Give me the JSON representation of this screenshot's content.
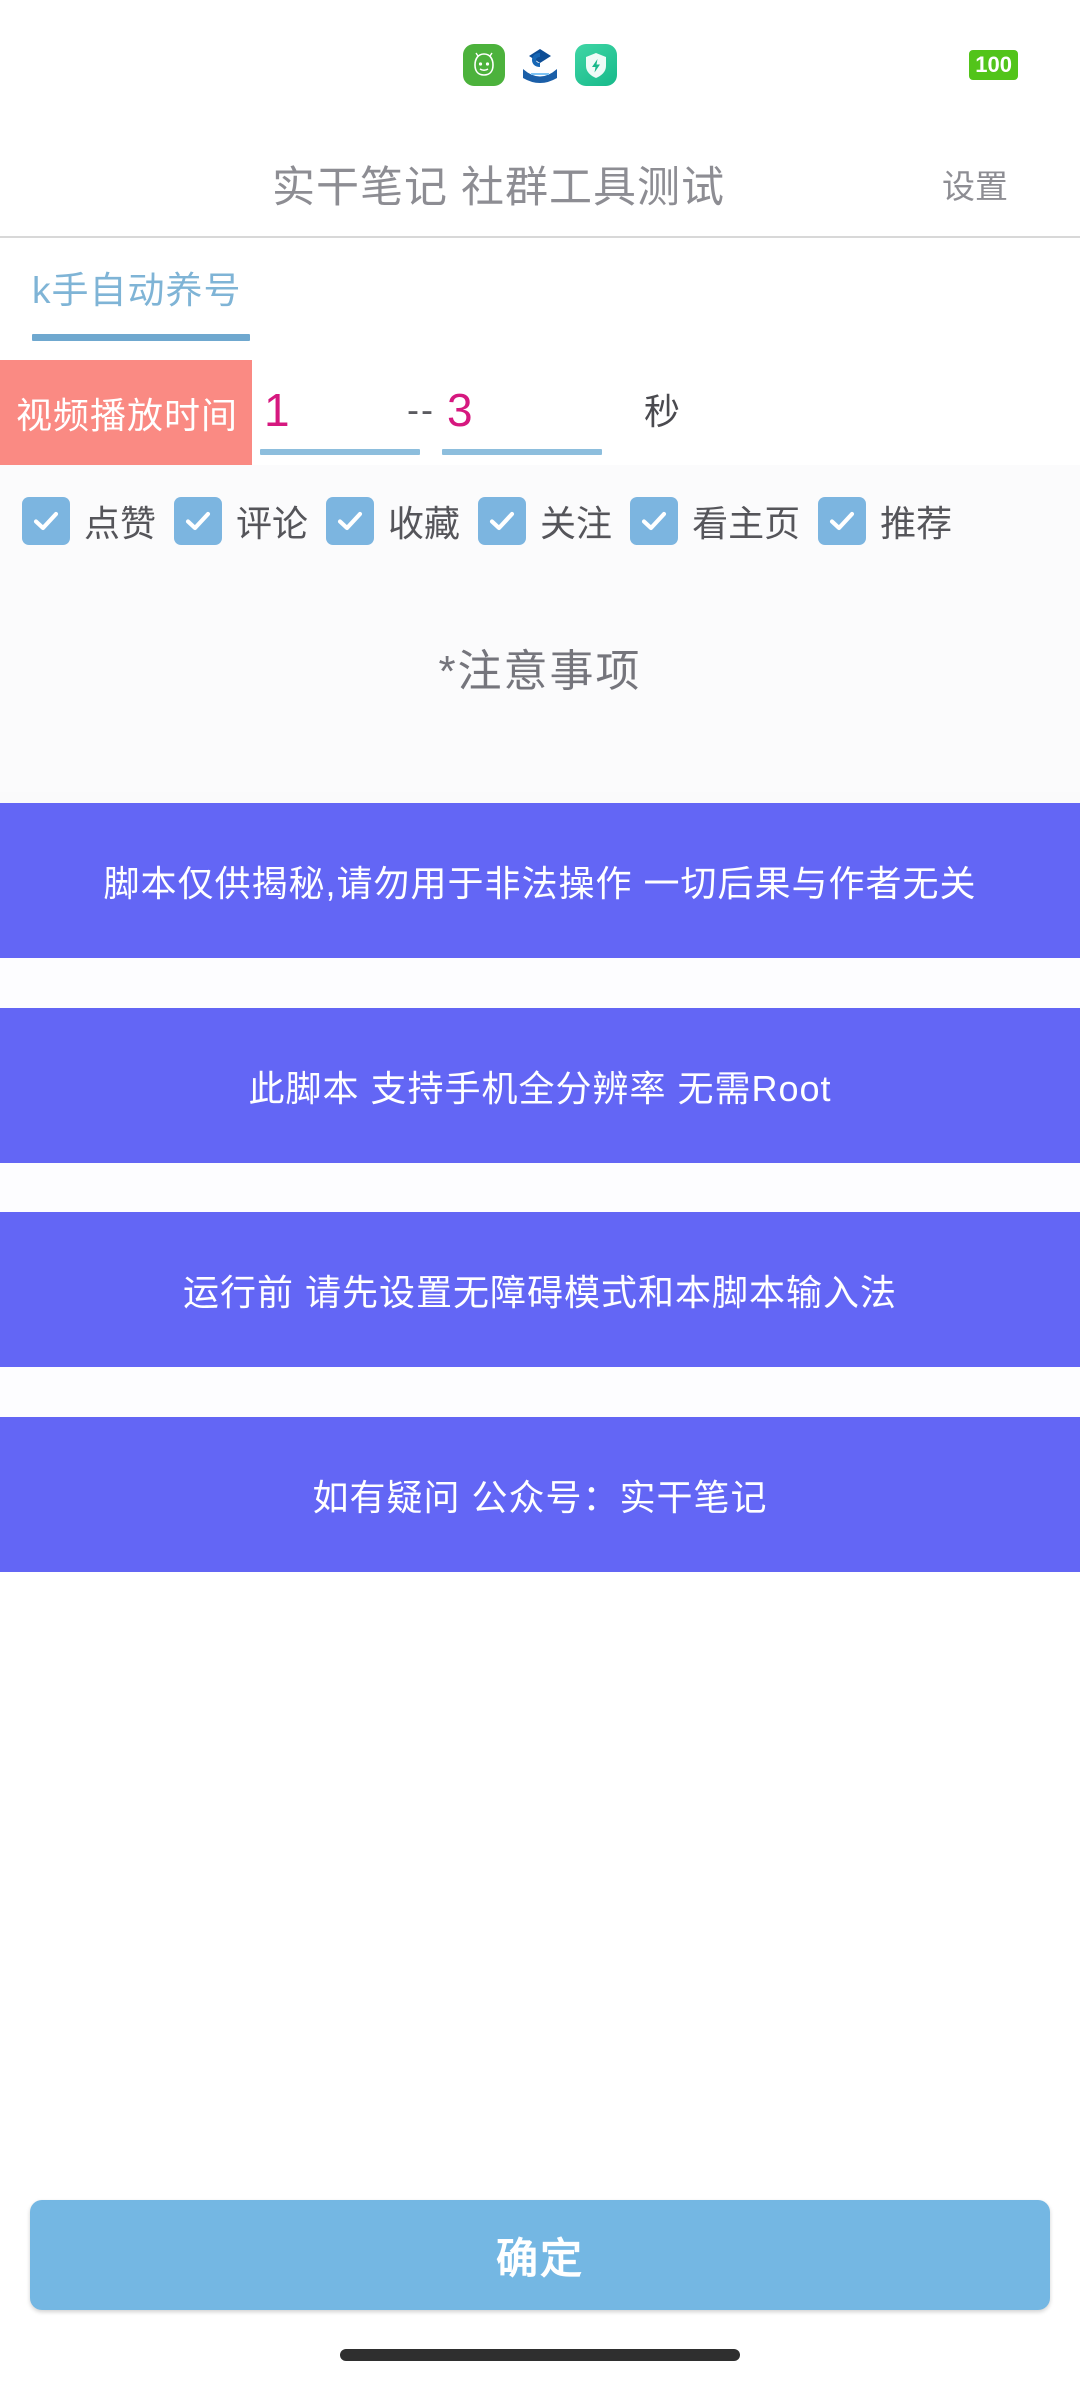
{
  "status_bar": {
    "notification_icons": [
      {
        "name": "robot-app-icon",
        "glyph": "robot"
      },
      {
        "name": "bank-app-icon",
        "glyph": "ccb-bank"
      },
      {
        "name": "security-shield-icon",
        "glyph": "shield-bolt"
      }
    ],
    "battery_level": "100"
  },
  "header": {
    "title": "实干笔记 社群工具测试",
    "settings_label": "设置"
  },
  "tabs": [
    {
      "label": "k手自动养号",
      "active": true
    }
  ],
  "form": {
    "time_label": "视频播放时间",
    "min_value": "1",
    "separator": "--",
    "max_value": "3",
    "unit": "秒",
    "min_placeholder": "1",
    "max_placeholder": "3"
  },
  "checkboxes": [
    {
      "label": "点赞",
      "checked": true
    },
    {
      "label": "评论",
      "checked": true
    },
    {
      "label": "收藏",
      "checked": true
    },
    {
      "label": "关注",
      "checked": true
    },
    {
      "label": "看主页",
      "checked": true
    },
    {
      "label": "推荐",
      "checked": true
    }
  ],
  "notes": {
    "heading": "*注意事项",
    "banners": [
      "脚本仅供揭秘,请勿用于非法操作 一切后果与作者无关",
      "此脚本 支持手机全分辨率 无需Root",
      "运行前 请先设置无障碍模式和本脚本输入法",
      "如有疑问 公众号：实干笔记"
    ]
  },
  "footer": {
    "confirm_label": "确定"
  },
  "colors": {
    "accent_blue": "#7cb5e0",
    "banner_purple": "#6366f5",
    "label_pink": "#fa8a83",
    "value_magenta": "#d6187f",
    "battery_green": "#52c41a",
    "confirm_blue": "#74b7e3"
  }
}
